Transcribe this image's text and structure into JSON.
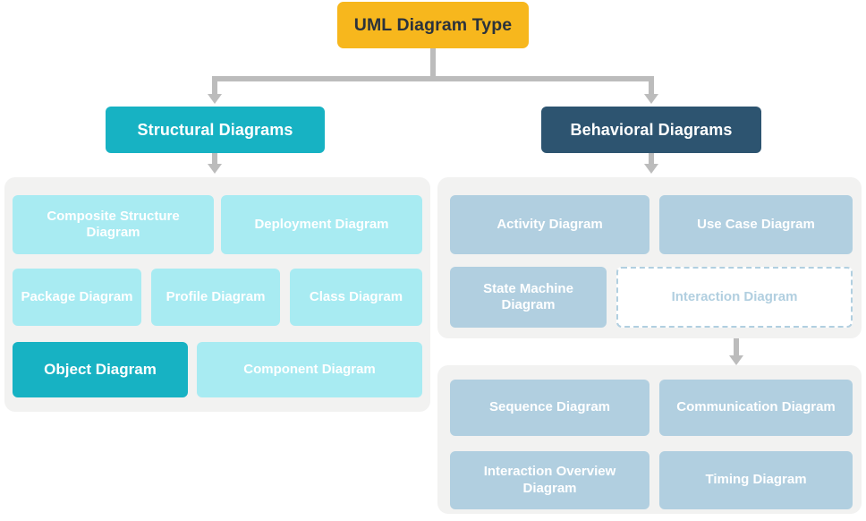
{
  "diagram": {
    "title": "UML Diagram Type",
    "root": {
      "label": "UML Diagram Type"
    },
    "branches": [
      {
        "label": "Structural Diagrams"
      },
      {
        "label": "Behavioral Diagrams"
      }
    ],
    "structural": {
      "rows": [
        [
          {
            "label": "Composite Structure Diagram",
            "style": "cyan"
          },
          {
            "label": "Deployment Diagram",
            "style": "cyan"
          }
        ],
        [
          {
            "label": "Package Diagram",
            "style": "cyan"
          },
          {
            "label": "Profile Diagram",
            "style": "cyan"
          },
          {
            "label": "Class Diagram",
            "style": "cyan"
          }
        ],
        [
          {
            "label": "Object Diagram",
            "style": "cyan-solid"
          },
          {
            "label": "Component Diagram",
            "style": "cyan"
          }
        ]
      ]
    },
    "behavioral": {
      "rows": [
        [
          {
            "label": "Activity Diagram",
            "style": "blue"
          },
          {
            "label": "Use Case Diagram",
            "style": "blue"
          }
        ],
        [
          {
            "label": "State Machine Diagram",
            "style": "blue"
          },
          {
            "label": "Interaction Diagram",
            "style": "dashed"
          }
        ]
      ]
    },
    "interaction": {
      "rows": [
        [
          {
            "label": "Sequence Diagram",
            "style": "blue"
          },
          {
            "label": "Communication Diagram",
            "style": "blue"
          }
        ],
        [
          {
            "label": "Interaction Overview Diagram",
            "style": "blue"
          },
          {
            "label": "Timing Diagram",
            "style": "blue"
          }
        ]
      ]
    },
    "colors": {
      "root": "#f7b71d",
      "root_text": "#2a323c",
      "structural": "#17b2c3",
      "behavioral": "#2d5470",
      "leaf_cyan": "#a8ebf2",
      "leaf_blue": "#b1cfe0",
      "panel": "#f2f2f1",
      "connector": "#bcbcbc",
      "dashed_border": "#b1cfe0"
    }
  }
}
